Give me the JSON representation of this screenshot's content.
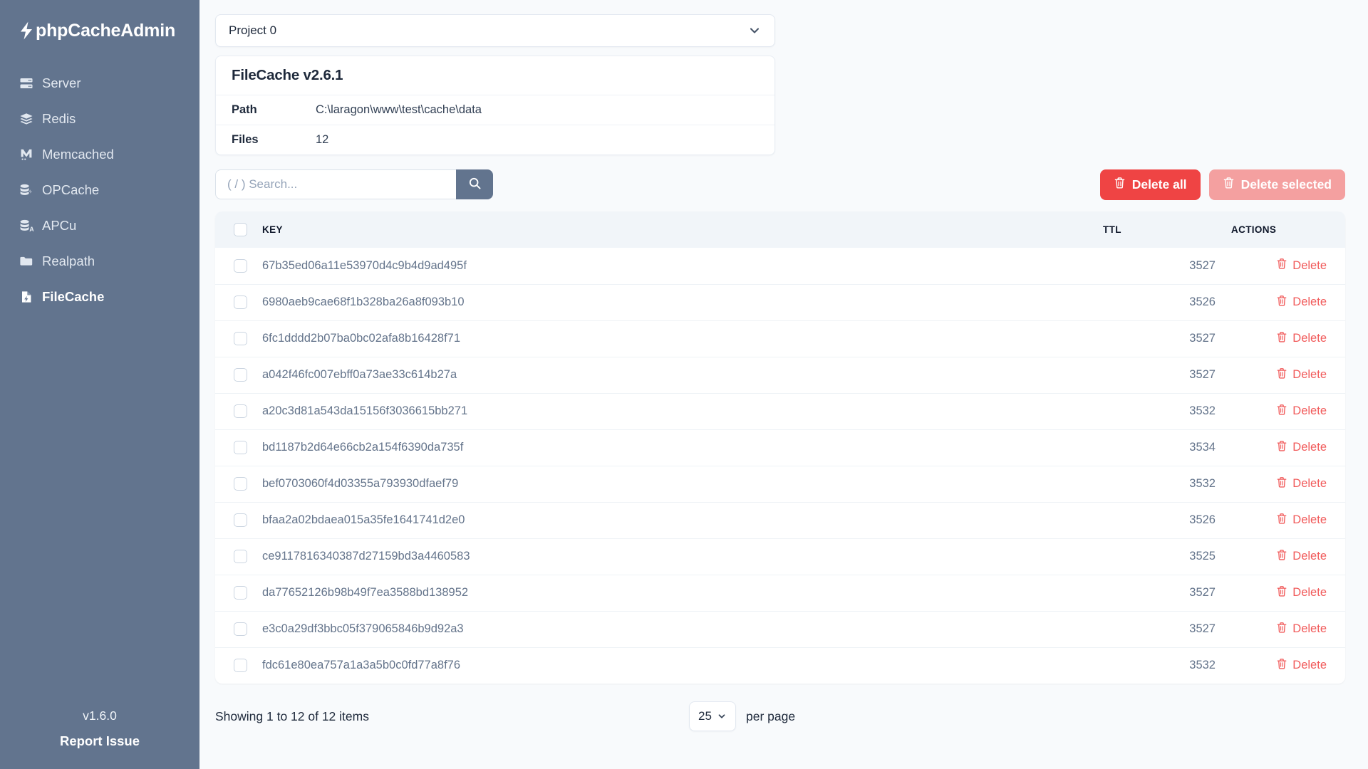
{
  "brand": {
    "name": "phpCacheAdmin",
    "icon": "bolt-icon"
  },
  "sidebar": {
    "items": [
      {
        "label": "Server",
        "icon": "server-icon",
        "active": false
      },
      {
        "label": "Redis",
        "icon": "layers-icon",
        "active": false
      },
      {
        "label": "Memcached",
        "icon": "memcached-icon",
        "active": false
      },
      {
        "label": "OPCache",
        "icon": "database-bolt-icon",
        "active": false
      },
      {
        "label": "APCu",
        "icon": "database-a-icon",
        "active": false
      },
      {
        "label": "Realpath",
        "icon": "folder-icon",
        "active": false
      },
      {
        "label": "FileCache",
        "icon": "file-bolt-icon",
        "active": true
      }
    ],
    "footer": {
      "version": "v1.6.0",
      "report_issue": "Report Issue"
    }
  },
  "project_select": {
    "selected": "Project 0",
    "icon": "chevron-down-icon"
  },
  "info_card": {
    "title": "FileCache v2.6.1",
    "rows": [
      {
        "key": "Path",
        "value": "C:\\laragon\\www\\test\\cache\\data"
      },
      {
        "key": "Files",
        "value": "12"
      }
    ]
  },
  "search": {
    "placeholder": "( / ) Search...",
    "value": "",
    "button_icon": "search-icon"
  },
  "toolbar": {
    "delete_all_label": "Delete all",
    "delete_selected_label": "Delete selected",
    "delete_all_icon": "trash-icon",
    "delete_selected_icon": "trash-icon",
    "delete_all_color": "#ef4444",
    "delete_selected_color": "#f4a0a0"
  },
  "table": {
    "columns": [
      "",
      "KEY",
      "TTL",
      "ACTIONS"
    ],
    "header_check_icon": "checkbox-icon",
    "row_action_label": "Delete",
    "row_action_icon": "trash-icon",
    "rows": [
      {
        "key": "67b35ed06a11e53970d4c9b4d9ad495f",
        "ttl": "3527"
      },
      {
        "key": "6980aeb9cae68f1b328ba26a8f093b10",
        "ttl": "3526"
      },
      {
        "key": "6fc1dddd2b07ba0bc02afa8b16428f71",
        "ttl": "3527"
      },
      {
        "key": "a042f46fc007ebff0a73ae33c614b27a",
        "ttl": "3527"
      },
      {
        "key": "a20c3d81a543da15156f3036615bb271",
        "ttl": "3532"
      },
      {
        "key": "bd1187b2d64e66cb2a154f6390da735f",
        "ttl": "3534"
      },
      {
        "key": "bef0703060f4d03355a793930dfaef79",
        "ttl": "3532"
      },
      {
        "key": "bfaa2a02bdaea015a35fe1641741d2e0",
        "ttl": "3526"
      },
      {
        "key": "ce9117816340387d27159bd3a4460583",
        "ttl": "3525"
      },
      {
        "key": "da77652126b98b49f7ea3588bd138952",
        "ttl": "3527"
      },
      {
        "key": "e3c0a29df3bbc05f379065846b9d92a3",
        "ttl": "3527"
      },
      {
        "key": "fdc61e80ea757a1a3a5b0c0fd77a8f76",
        "ttl": "3532"
      }
    ]
  },
  "footer": {
    "showing": "Showing 1 to 12 of 12 items",
    "per_page_value": "25",
    "per_page_label": "per page",
    "per_page_icon": "chevron-down-icon"
  },
  "colors": {
    "sidebar_bg": "#62748e",
    "page_bg": "#f8fafc",
    "table_header_bg": "#f1f5f9",
    "danger": "#ef4444",
    "danger_muted": "#f4a0a0",
    "key_text": "#64748b"
  }
}
